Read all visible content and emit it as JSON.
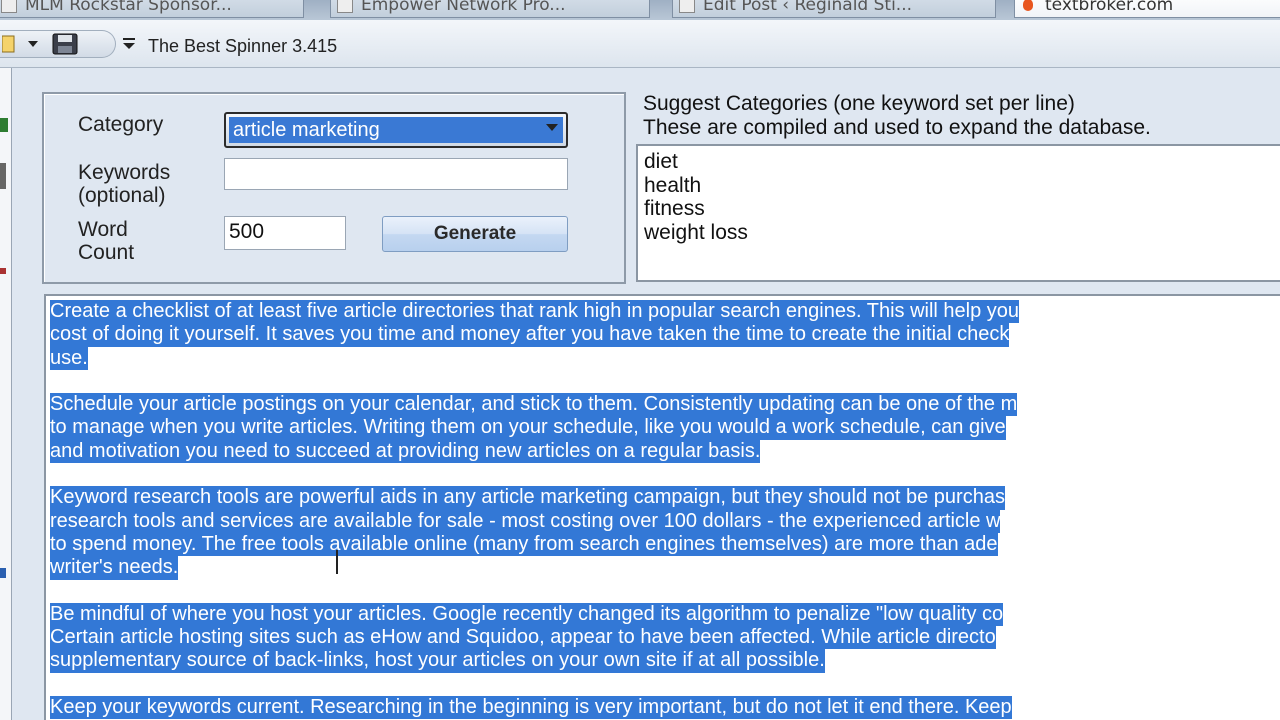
{
  "browser_tabs": [
    {
      "label": "MLM Rockstar Sponsor..."
    },
    {
      "label": "Empower Network Pro..."
    },
    {
      "label": "Edit Post ‹ Reginald Sti..."
    },
    {
      "label": "textbroker.com"
    }
  ],
  "app": {
    "title": "The Best Spinner 3.415"
  },
  "form": {
    "category_label": "Category",
    "category_value": "article marketing",
    "keywords_label_1": "Keywords",
    "keywords_label_2": "(optional)",
    "keywords_value": "",
    "word_count_label_1": "Word",
    "word_count_label_2": "Count",
    "word_count_value": "500",
    "generate_label": "Generate"
  },
  "suggest": {
    "title_line1": "Suggest Categories (one keyword set per line)",
    "title_line2": "These are compiled and used to expand the database.",
    "items": [
      "diet",
      "health",
      "fitness",
      "weight loss"
    ]
  },
  "article": {
    "paragraphs": [
      [
        "Create a checklist of at least five article directories that rank high in popular search engines. This will help you",
        "cost of doing it yourself. It saves you time and money after you have taken the time to create the initial check",
        "use."
      ],
      [
        "Schedule your article postings on your calendar, and stick to them. Consistently updating can be one of the m",
        "to manage when you write articles. Writing them on your schedule, like you would a work schedule, can give",
        "and motivation you need to succeed at providing new articles on a regular basis."
      ],
      [
        "Keyword research tools are powerful aids in any article marketing campaign, but they should not be purchas",
        "research tools and services are available for sale - most costing over 100 dollars - the experienced article w",
        "to spend money. The free tools available online (many from search engines themselves) are more than ade",
        "writer's needs."
      ],
      [
        "Be mindful of where you host your articles.  Google recently changed its algorithm to penalize \"low quality co",
        "Certain article hosting sites such as eHow and Squidoo, appear to have been affected.  While article directo",
        "supplementary source of back-links, host your articles on your own site if at all possible."
      ],
      [
        "Keep your keywords current. Researching in the beginning is very important, but do not let it end there. Keep"
      ]
    ]
  }
}
